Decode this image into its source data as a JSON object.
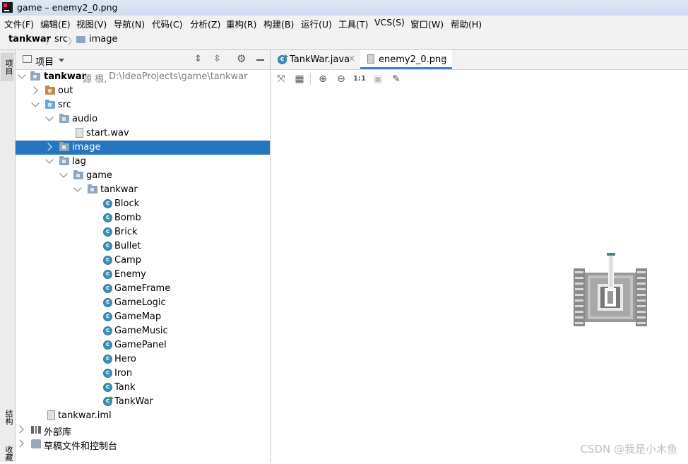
{
  "window": {
    "title": "game – enemy2_0.png"
  },
  "menu": [
    "文件(F)",
    "编辑(E)",
    "视图(V)",
    "导航(N)",
    "代码(C)",
    "分析(Z)",
    "重构(R)",
    "构建(B)",
    "运行(U)",
    "工具(T)",
    "VCS(S)",
    "窗口(W)",
    "帮助(H)"
  ],
  "breadcrumb": {
    "project": "tankwar",
    "src": "src",
    "image": "image"
  },
  "sidebar_left": {
    "project_tab": "项目",
    "structure_tab": "结构",
    "bookmark_tab": "收藏"
  },
  "project_panel": {
    "title": "项目",
    "root": {
      "name": "tankwar",
      "tag": "源 根,",
      "path": "D:\\IdeaProjects\\game\\tankwar"
    },
    "items": {
      "out": "out",
      "src": "src",
      "audio": "audio",
      "start_wav": "start.wav",
      "image": "image",
      "lag": "lag",
      "game": "game",
      "tankwar_pkg": "tankwar",
      "classes": [
        "Block",
        "Bomb",
        "Brick",
        "Bullet",
        "Camp",
        "Enemy",
        "GameFrame",
        "GameLogic",
        "GameMap",
        "GameMusic",
        "GamePanel",
        "Hero",
        "Iron",
        "Tank",
        "TankWar"
      ],
      "iml": "tankwar.iml",
      "external_libs": "外部库",
      "scratches": "草稿文件和控制台"
    }
  },
  "editor": {
    "tabs": [
      {
        "label": "TankWar.java",
        "active": false
      },
      {
        "label": "enemy2_0.png",
        "active": true
      }
    ],
    "image_toolbar": {
      "actual_size": "1:1"
    }
  },
  "watermark": "CSDN @我是小木鱼"
}
